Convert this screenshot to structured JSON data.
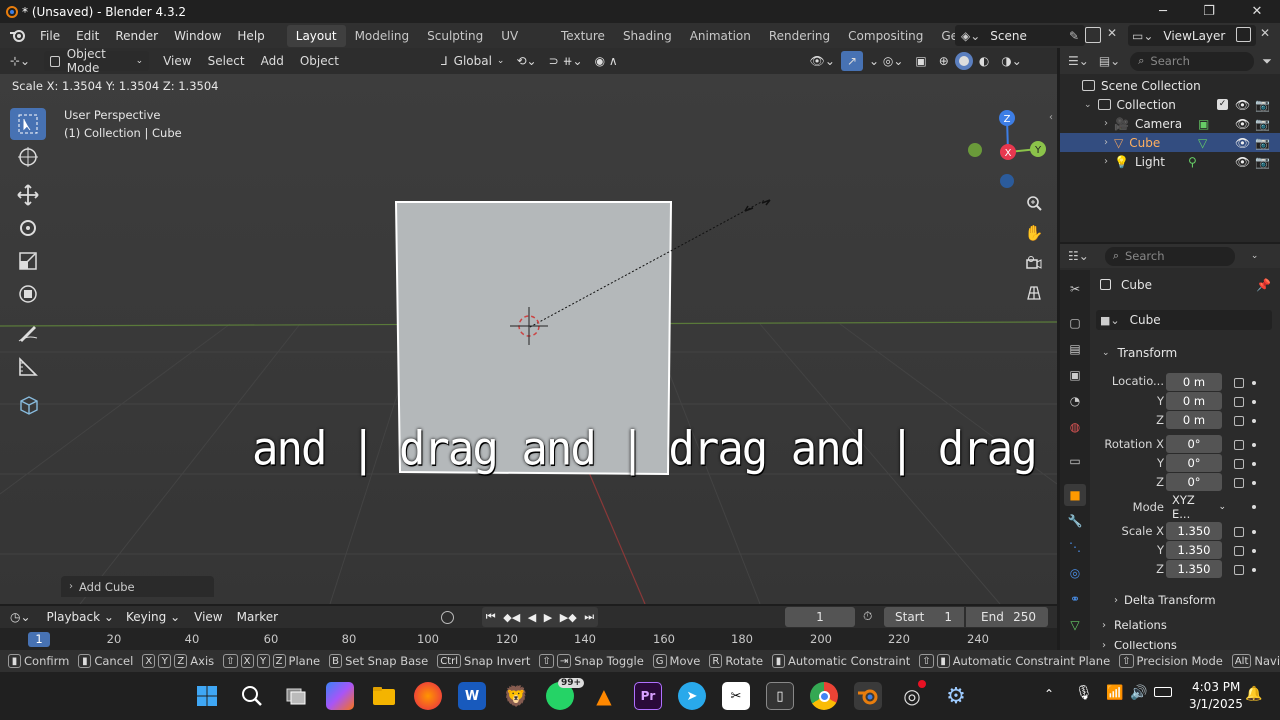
{
  "window": {
    "title": "* (Unsaved) - Blender 4.3.2",
    "minimize_glyph": "─",
    "maximize_glyph": "❐",
    "close_glyph": "✕"
  },
  "topbar": {
    "menus": [
      "File",
      "Edit",
      "Render",
      "Window",
      "Help"
    ],
    "workspaces": [
      "Layout",
      "Modeling",
      "Sculpting",
      "UV Editing",
      "Texture Paint",
      "Shading",
      "Animation",
      "Rendering",
      "Compositing",
      "Geome"
    ],
    "active_workspace": "Layout",
    "scene": "Scene",
    "view_layer": "ViewLayer"
  },
  "viewport": {
    "mode": "Object Mode",
    "menus": [
      "View",
      "Select",
      "Add",
      "Object"
    ],
    "transform_orientation": "Global",
    "operator_status": "Scale X: 1.3504   Y: 1.3504   Z: 1.3504",
    "perspective_label": "User Perspective",
    "collection_label": "(1) Collection | Cube",
    "last_operator": "Add Cube",
    "gizmo": {
      "z": "Z",
      "x": "X",
      "y": "Y"
    },
    "caption": "and | drag and | drag and | drag"
  },
  "outliner": {
    "search_placeholder": "Search",
    "items": [
      {
        "label": "Scene Collection"
      },
      {
        "label": "Collection"
      },
      {
        "label": "Camera"
      },
      {
        "label": "Cube",
        "selected": true
      },
      {
        "label": "Light"
      }
    ]
  },
  "properties": {
    "search_placeholder": "Search",
    "object_name": "Cube",
    "object_field": "Cube",
    "transform_panel": "Transform",
    "location_label": "Locatio...",
    "location": {
      "x": "0 m",
      "y": "0 m",
      "z": "0 m"
    },
    "rotation_label": "Rotation X",
    "rotation": {
      "x": "0°",
      "y": "0°",
      "z": "0°"
    },
    "mode_label": "Mode",
    "mode_value": "XYZ E...",
    "scale_label": "Scale X",
    "scale": {
      "x": "1.350",
      "y": "1.350",
      "z": "1.350"
    },
    "axis_y": "Y",
    "axis_z": "Z",
    "delta_transform": "Delta Transform",
    "relations": "Relations",
    "collections": "Collections"
  },
  "timeline": {
    "menus": [
      "Playback",
      "Keying",
      "View",
      "Marker"
    ],
    "current_frame": "1",
    "start_label": "Start",
    "start": "1",
    "end_label": "End",
    "end": "250",
    "ruler": [
      "1",
      "20",
      "40",
      "60",
      "80",
      "100",
      "120",
      "140",
      "160",
      "180",
      "200",
      "220",
      "240"
    ]
  },
  "statusbar": {
    "confirm": "Confirm",
    "cancel": "Cancel",
    "axis": "Axis",
    "plane": "Plane",
    "snap_base_key": "B",
    "snap_base": "Set Snap Base",
    "snap_invert_key": "Ctrl",
    "snap_invert": "Snap Invert",
    "snap_toggle": "Snap Toggle",
    "move_key": "G",
    "move": "Move",
    "rotate_key": "R",
    "rotate": "Rotate",
    "auto_constraint": "Automatic Constraint",
    "auto_constraint_plane": "Automatic Constraint Plane",
    "precision": "Precision Mode",
    "navigate_key": "Alt",
    "navigate": "Navigate",
    "key_x": "X",
    "key_y": "Y",
    "key_z": "Z"
  },
  "taskbar": {
    "time": "4:03 PM",
    "date": "3/1/2025",
    "whatsapp_badge": "99+",
    "word_label": "W",
    "premiere_label": "Pr"
  },
  "colors": {
    "accent_blue": "#4772b3",
    "selection": "#334d80",
    "axis_x": "#e8384f",
    "axis_y": "#8bc34a",
    "axis_z": "#3d7ee6"
  }
}
